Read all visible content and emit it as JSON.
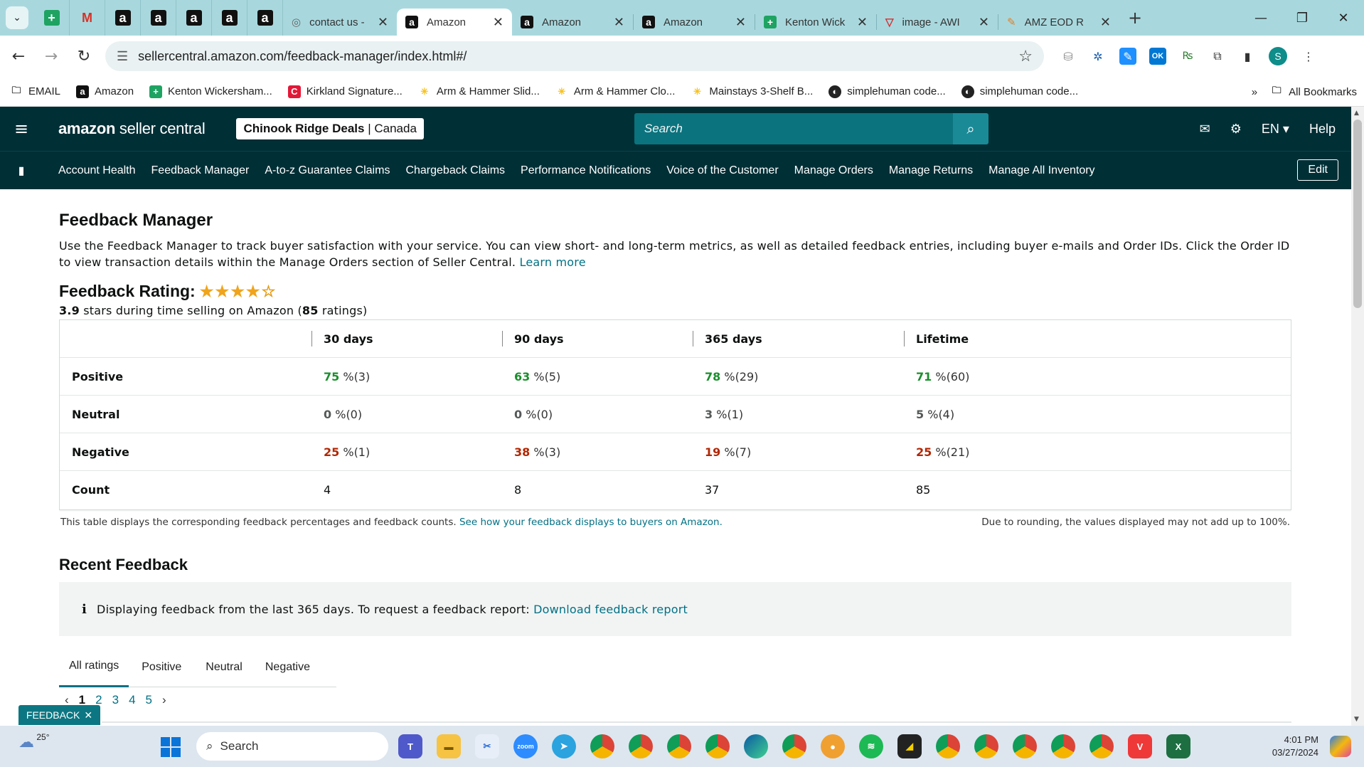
{
  "browser": {
    "tabs": [
      {
        "label": "contact us -",
        "icon": "globe-icon"
      },
      {
        "label": "Amazon",
        "icon": "amazon-icon",
        "active": true
      },
      {
        "label": "Amazon",
        "icon": "amazon-icon"
      },
      {
        "label": "Amazon",
        "icon": "amazon-icon"
      },
      {
        "label": "Kenton Wick",
        "icon": "sheets-icon"
      },
      {
        "label": "image - AWI",
        "icon": "vivaldi-icon"
      },
      {
        "label": "AMZ EOD R",
        "icon": "pencil-icon"
      }
    ],
    "url": "sellercentral.amazon.com/feedback-manager/index.html#/",
    "ext_badge": "OK",
    "profile_initial": "S",
    "bookmarks": [
      {
        "label": "EMAIL",
        "icon": "folder-icon"
      },
      {
        "label": "Amazon",
        "icon": "amazon-icon"
      },
      {
        "label": "Kenton Wickersham...",
        "icon": "sheets-icon"
      },
      {
        "label": "Kirkland Signature...",
        "icon": "costco-icon"
      },
      {
        "label": "Arm & Hammer Slid...",
        "icon": "walmart-icon"
      },
      {
        "label": "Arm & Hammer Clo...",
        "icon": "walmart-icon"
      },
      {
        "label": "Mainstays 3-Shelf B...",
        "icon": "walmart-icon"
      },
      {
        "label": "simplehuman code...",
        "icon": "simplehuman-icon"
      },
      {
        "label": "simplehuman code...",
        "icon": "simplehuman-icon"
      }
    ],
    "all_bookmarks": "All Bookmarks"
  },
  "header": {
    "logo_brand": "amazon",
    "logo_product": "seller central",
    "account_name": "Chinook Ridge Deals",
    "marketplace": "Canada",
    "search_placeholder": "Search",
    "language": "EN",
    "help": "Help"
  },
  "subnav": {
    "items": [
      "Account Health",
      "Feedback Manager",
      "A-to-z Guarantee Claims",
      "Chargeback Claims",
      "Performance Notifications",
      "Voice of the Customer",
      "Manage Orders",
      "Manage Returns",
      "Manage All Inventory"
    ],
    "edit": "Edit"
  },
  "page": {
    "title": "Feedback Manager",
    "description": "Use the Feedback Manager to track buyer satisfaction with your service. You can view short- and long-term metrics, as well as detailed feedback entries, including buyer e-mails and Order IDs. Click the Order ID to view transaction details within the Manage Orders section of Seller Central.",
    "learn_more": "Learn more",
    "rating_label": "Feedback Rating:",
    "rating_stars": 4,
    "rating_value": "3.9",
    "rating_mid": "stars during time selling on Amazon (",
    "rating_count": "85",
    "rating_suffix": "ratings)"
  },
  "feedback_table": {
    "columns": [
      "30 days",
      "90 days",
      "365 days",
      "Lifetime"
    ],
    "rows": [
      {
        "label": "Positive",
        "cells": [
          {
            "v": "75",
            "n": "%(3)"
          },
          {
            "v": "63",
            "n": "%(5)"
          },
          {
            "v": "78",
            "n": "%(29)"
          },
          {
            "v": "71",
            "n": "%(60)"
          }
        ]
      },
      {
        "label": "Neutral",
        "cells": [
          {
            "v": "0",
            "n": "%(0)"
          },
          {
            "v": "0",
            "n": "%(0)"
          },
          {
            "v": "3",
            "n": "%(1)"
          },
          {
            "v": "5",
            "n": "%(4)"
          }
        ]
      },
      {
        "label": "Negative",
        "cells": [
          {
            "v": "25",
            "n": "%(1)"
          },
          {
            "v": "38",
            "n": "%(3)"
          },
          {
            "v": "19",
            "n": "%(7)"
          },
          {
            "v": "25",
            "n": "%(21)"
          }
        ]
      },
      {
        "label": "Count",
        "cells": [
          {
            "v": "4"
          },
          {
            "v": "8"
          },
          {
            "v": "37"
          },
          {
            "v": "85"
          }
        ]
      }
    ],
    "note": "This table displays the corresponding feedback percentages and feedback counts.",
    "note_link": "See how your feedback displays to buyers on Amazon.",
    "rounding_note": "Due to rounding, the values displayed may not add up to 100%."
  },
  "recent": {
    "title": "Recent Feedback",
    "info": "Displaying feedback from the last 365 days. To request a feedback report:",
    "info_link": "Download feedback report",
    "tabs": [
      "All ratings",
      "Positive",
      "Neutral",
      "Negative"
    ],
    "pages": [
      "1",
      "2",
      "3",
      "4",
      "5"
    ]
  },
  "feedback_button": "FEEDBACK",
  "taskbar": {
    "temperature": "25°",
    "search": "Search",
    "time": "4:01 PM",
    "date": "03/27/2024"
  },
  "colors": {
    "header_bg": "#002f36",
    "link": "#007185",
    "positive": "#1b8f2d",
    "negative": "#b12704"
  }
}
